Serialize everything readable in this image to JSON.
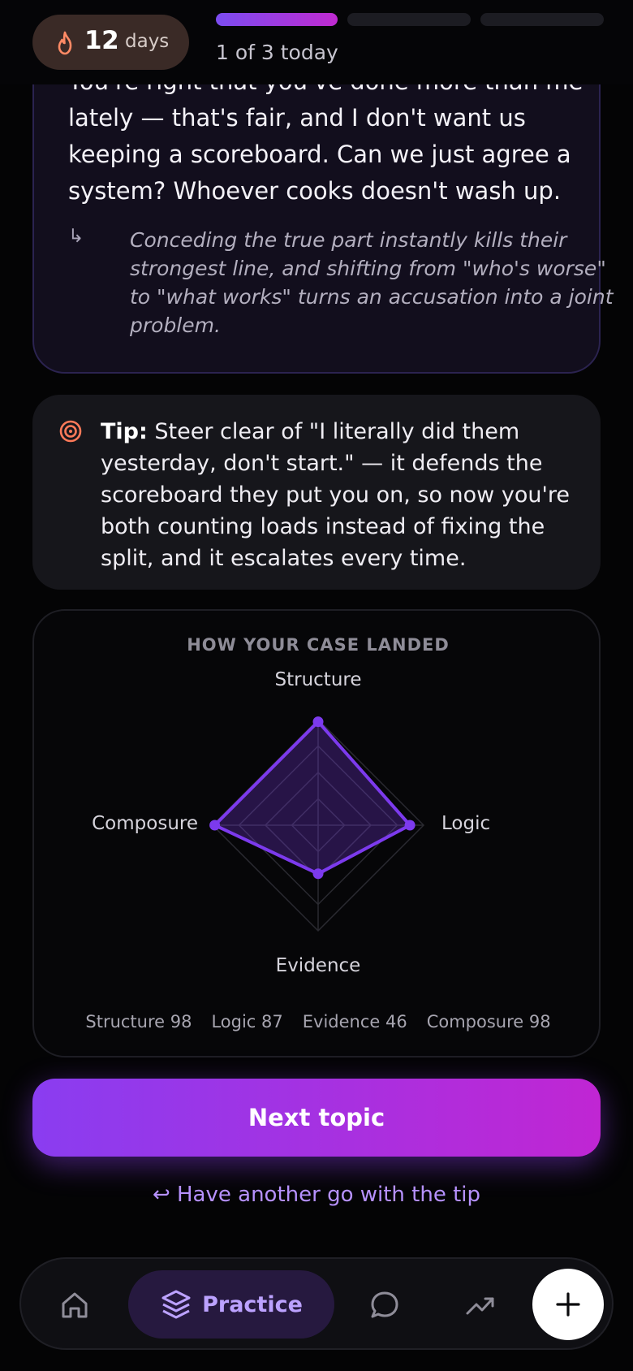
{
  "header": {
    "streak_count": "12",
    "streak_unit": "days",
    "progress_label": "1 of 3 today",
    "progress_completed": 1,
    "progress_total": 3
  },
  "answer": {
    "lines": [
      "You're right that you've done more than me",
      "lately — that's fair, and I don't want us",
      "keeping a scoreboard. Can we just agree a",
      "system? Whoever cooks doesn't wash up."
    ],
    "annotation_arrow": "↳",
    "annotation_lines": [
      "Conceding the true part instantly kills their",
      "strongest line, and shifting from \"who's worse\"",
      "to \"what works\" turns an accusation into a joint",
      "problem."
    ]
  },
  "tip": {
    "label": "Tip:",
    "lines": [
      " Steer clear of \"I literally did them",
      "yesterday, don't start.\" — it defends the",
      "scoreboard they put you on, so now you're",
      "both counting loads instead of fixing the",
      "split, and it escalates every time."
    ]
  },
  "radar": {
    "title": "HOW YOUR CASE LANDED",
    "axes": [
      "Structure",
      "Logic",
      "Evidence",
      "Composure"
    ],
    "scores_text": [
      "Structure 98",
      "Logic 87",
      "Evidence 46",
      "Composure 98"
    ]
  },
  "chart_data": {
    "type": "radar",
    "title": "HOW YOUR CASE LANDED",
    "categories": [
      "Structure",
      "Logic",
      "Evidence",
      "Composure"
    ],
    "values": [
      98,
      87,
      46,
      98
    ],
    "range": [
      0,
      100
    ],
    "accent_color": "#7c3aed"
  },
  "actions": {
    "next_label": "Next topic",
    "retry_label": "↩ Have another go with the tip"
  },
  "nav": {
    "items": [
      {
        "icon": "home-icon"
      },
      {
        "icon": "layers-icon",
        "label": "Practice"
      },
      {
        "icon": "chat-icon"
      },
      {
        "icon": "trend-icon"
      }
    ],
    "fab_icon": "plus-icon"
  }
}
